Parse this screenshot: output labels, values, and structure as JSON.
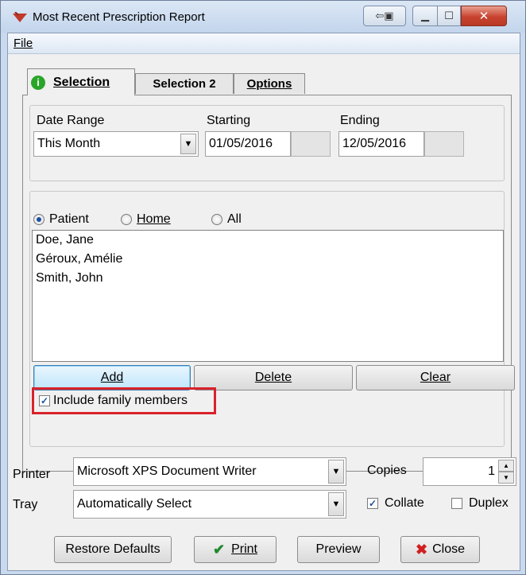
{
  "window": {
    "title": "Most Recent Prescription Report"
  },
  "menu": {
    "file": "File"
  },
  "tabs": [
    {
      "label": "Selection",
      "active": true,
      "icon": "info-icon"
    },
    {
      "label": "Selection 2",
      "active": false
    },
    {
      "label": "Options",
      "active": false
    }
  ],
  "date_range": {
    "label": "Date Range",
    "value": "This Month",
    "starting_label": "Starting",
    "starting_value": "01/05/2016",
    "ending_label": "Ending",
    "ending_value": "12/05/2016"
  },
  "scope": {
    "options": [
      "Patient",
      "Home",
      "All"
    ],
    "selected": "Patient"
  },
  "patients": [
    "Doe, Jane",
    "Géroux, Amélie",
    "Smith, John"
  ],
  "list_buttons": {
    "add": "Add",
    "delete": "Delete",
    "clear": "Clear"
  },
  "include_family": {
    "label": "Include family members",
    "checked": true
  },
  "printer": {
    "label": "Printer",
    "value": "Microsoft XPS Document Writer"
  },
  "tray": {
    "label": "Tray",
    "value": "Automatically Select"
  },
  "copies": {
    "label": "Copies",
    "value": "1"
  },
  "collate": {
    "label": "Collate",
    "checked": true
  },
  "duplex": {
    "label": "Duplex",
    "checked": false
  },
  "actions": {
    "restore": "Restore Defaults",
    "print": "Print",
    "preview": "Preview",
    "close": "Close"
  }
}
